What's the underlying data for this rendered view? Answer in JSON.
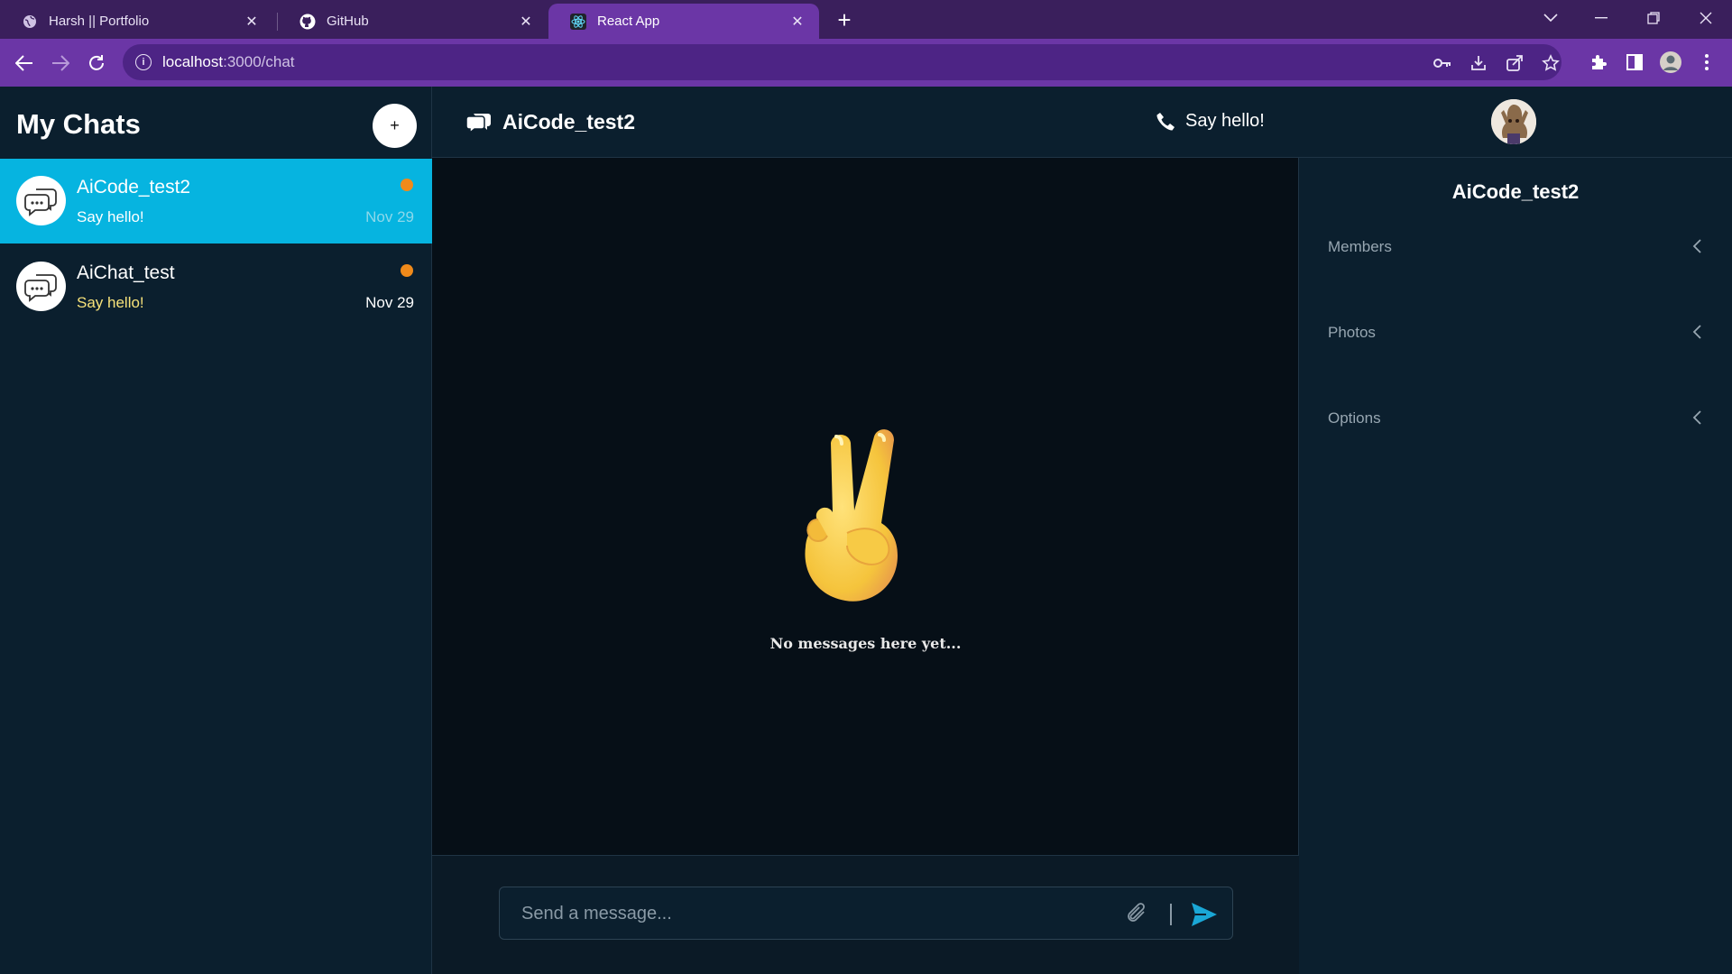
{
  "browser": {
    "tabs": [
      {
        "title": "Harsh || Portfolio",
        "icon": "globe-icon",
        "active": false
      },
      {
        "title": "GitHub",
        "icon": "github-icon",
        "active": false
      },
      {
        "title": "React App",
        "icon": "react-icon",
        "active": true
      }
    ],
    "url_host": "localhost",
    "url_path": ":3000/chat"
  },
  "sidebar": {
    "title": "My Chats",
    "add_label": "+",
    "chats": [
      {
        "name": "AiCode_test2",
        "preview": "Say hello!",
        "date": "Nov 29",
        "active": true,
        "unread": true
      },
      {
        "name": "AiChat_test",
        "preview": "Say hello!",
        "date": "Nov 29",
        "active": false,
        "unread": true
      }
    ]
  },
  "feed": {
    "title": "AiCode_test2",
    "subtitle": "Say hello!",
    "empty_text": "No messages here yet...",
    "composer": {
      "placeholder": "Send a message..."
    }
  },
  "settings": {
    "title": "AiCode_test2",
    "sections": [
      "Members",
      "Photos",
      "Options"
    ]
  },
  "colors": {
    "accent": "#06b4e0",
    "unread_dot": "#f08a1a",
    "browser_frame": "#6b36a6"
  }
}
